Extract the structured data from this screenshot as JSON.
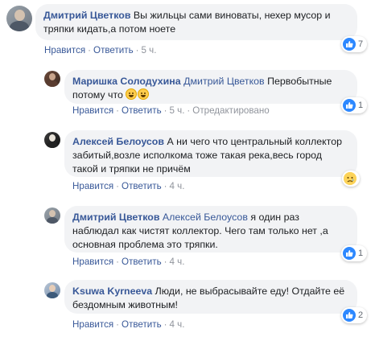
{
  "comments": [
    {
      "author": "Дмитрий Цветков",
      "mention": "",
      "text": "Вы жильцы сами виноваты, нехер мусор и тряпки кидать,а потом ноете",
      "like": "Нравится",
      "reply": "Ответить",
      "time": "5 ч.",
      "edited": "",
      "reaction": {
        "icon": "like-icon",
        "count": "7"
      }
    },
    {
      "author": "Маришка Солодухина",
      "mention": "Дмитрий Цветков",
      "text": "Первобытные потому что",
      "emojis": [
        "grinning-face-icon",
        "grinning-face-icon"
      ],
      "like": "Нравится",
      "reply": "Ответить",
      "time": "5 ч.",
      "edited": "Отредактировано",
      "reaction": {
        "icon": "like-icon",
        "count": "1"
      }
    },
    {
      "author": "Алексей Белоусов",
      "mention": "",
      "text": "А ни чего что центральный коллектор забитый,возле исполкома тоже такая река,весь город такой и тряпки не причём",
      "like": "Нравится",
      "reply": "Ответить",
      "time": "4 ч.",
      "edited": "",
      "reaction": {
        "icon": "sad-face-icon",
        "count": ""
      }
    },
    {
      "author": "Дмитрий Цветков",
      "mention": "Алексей Белоусов",
      "text": "я один раз наблюдал как чистят коллектор. Чего там только нет ,а основная проблема это тряпки.",
      "like": "Нравится",
      "reply": "Ответить",
      "time": "4 ч.",
      "edited": "",
      "reaction": {
        "icon": "like-icon",
        "count": "1"
      }
    },
    {
      "author": "Ksuwa Kyrneeva",
      "mention": "",
      "text": "Люди, не выбрасывайте еду! Отдайте её бездомным животным!",
      "like": "Нравится",
      "reply": "Ответить",
      "time": "4 ч.",
      "edited": "",
      "reaction": {
        "icon": "like-icon",
        "count": "2"
      }
    }
  ],
  "colors": {
    "link": "#385898",
    "bubble": "#f2f3f5",
    "meta": "#90949c",
    "like": "#2d88ff"
  }
}
